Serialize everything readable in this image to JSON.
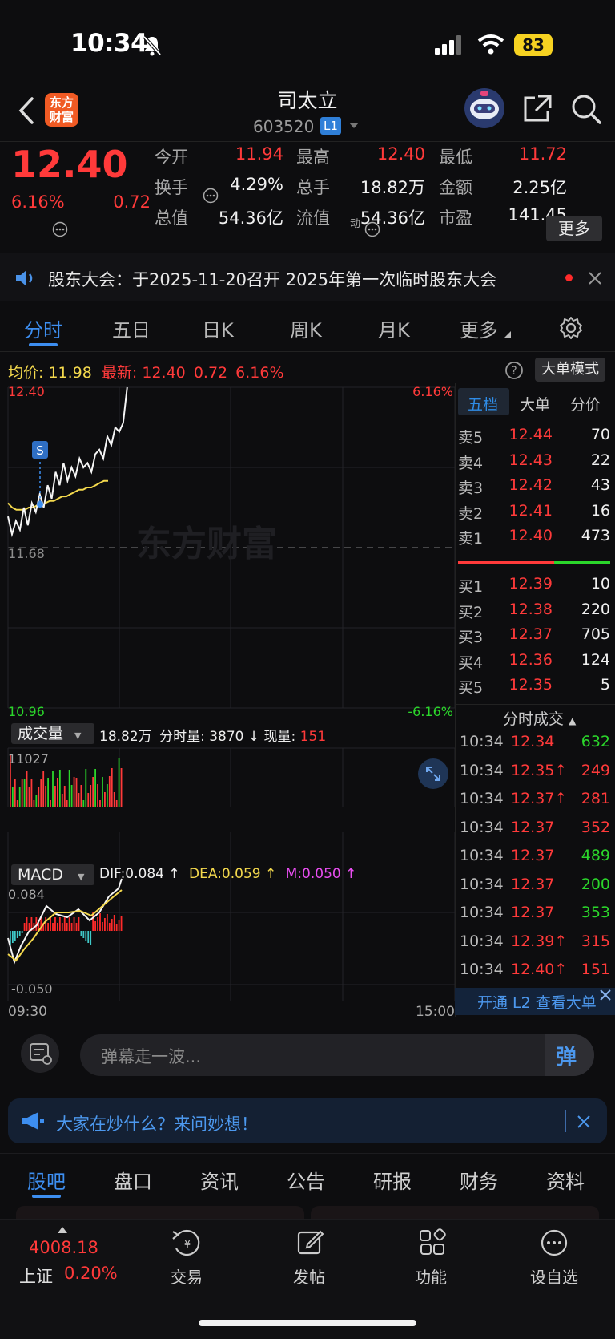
{
  "status": {
    "time": "10:34",
    "battery": "83"
  },
  "header": {
    "logo_text": "东方\n财富",
    "name": "司太立",
    "code": "603520",
    "badge": "L1"
  },
  "quote": {
    "price": "12.40",
    "change_pct": "6.16%",
    "change": "0.72",
    "rows": [
      [
        {
          "k": "今开",
          "v": "11.94",
          "c": "red"
        },
        {
          "k": "最高",
          "v": "12.40",
          "c": "red"
        },
        {
          "k": "最低",
          "v": "11.72",
          "c": "red"
        }
      ],
      [
        {
          "k": "换手",
          "v": "4.29%",
          "c": "white"
        },
        {
          "k": "总手",
          "v": "18.82万",
          "c": "white"
        },
        {
          "k": "金额",
          "v": "2.25亿",
          "c": "white"
        }
      ],
      [
        {
          "k": "总值",
          "v": "54.36亿",
          "c": "white"
        },
        {
          "k": "流值",
          "v": "54.36亿",
          "c": "white"
        },
        {
          "k": "市盈",
          "v": "141.45",
          "c": "white"
        }
      ]
    ],
    "pe_sup": "动",
    "more": "更多"
  },
  "notice": {
    "text": "股东大会：于2025-11-20召开 2025年第一次临时股东大会"
  },
  "tabs": [
    "分时",
    "五日",
    "日K",
    "周K",
    "月K",
    "更多"
  ],
  "chart_info": {
    "avg_label": "均价:",
    "avg": "11.98",
    "latest_label": "最新:",
    "latest": "12.40",
    "chg": "0.72",
    "pct": "6.16%",
    "mode_btn": "大单模式",
    "y_top": "12.40",
    "y_mid": "11.68",
    "y_bot": "10.96",
    "pct_top": "6.16%",
    "pct_bot": "-6.16%",
    "s_marker": "S",
    "watermark": "东方财富"
  },
  "chart_data": {
    "type": "line",
    "x_range": [
      "09:30",
      "15:00"
    ],
    "ylim": [
      10.96,
      12.4
    ],
    "series": [],
    "price_points": [
      11.82,
      11.74,
      11.8,
      11.76,
      11.86,
      11.78,
      11.88,
      11.84,
      11.92,
      11.86,
      11.96,
      11.9,
      12.02,
      11.96,
      12.06,
      11.98,
      12.04,
      12.0,
      12.08,
      12.04,
      12.06,
      12.02,
      12.1,
      12.12,
      12.08,
      12.18,
      12.14,
      12.22,
      12.2,
      12.24,
      12.4
    ],
    "avg_points": [
      11.88,
      11.86,
      11.85,
      11.85,
      11.85,
      11.86,
      11.86,
      11.87,
      11.87,
      11.88,
      11.89,
      11.89,
      11.9,
      11.91,
      11.91,
      11.92,
      11.93,
      11.94,
      11.94,
      11.95,
      11.95,
      11.96,
      11.97,
      11.98,
      11.98
    ],
    "volume": {
      "label": "成交量",
      "total": "18.82万",
      "period_label": "分时量:",
      "period": "3870",
      "current_label": "现量:",
      "current": "151",
      "max": "11027"
    },
    "macd": {
      "label": "MACD",
      "dif": "DIF:0.084",
      "dea": "DEA:0.059",
      "m": "M:0.050",
      "top": "0.084",
      "bot": "-0.050"
    }
  },
  "orderbook": {
    "tabs": [
      "五档",
      "大单",
      "分价"
    ],
    "asks": [
      [
        "卖5",
        "12.44",
        "70"
      ],
      [
        "卖4",
        "12.43",
        "22"
      ],
      [
        "卖3",
        "12.42",
        "43"
      ],
      [
        "卖2",
        "12.41",
        "16"
      ],
      [
        "卖1",
        "12.40",
        "473"
      ]
    ],
    "bids": [
      [
        "买1",
        "12.39",
        "10"
      ],
      [
        "买2",
        "12.38",
        "220"
      ],
      [
        "买3",
        "12.37",
        "705"
      ],
      [
        "买4",
        "12.36",
        "124"
      ],
      [
        "买5",
        "12.35",
        "5"
      ]
    ],
    "ticks_title": "分时成交",
    "ticks": [
      [
        "10:34",
        "12.34",
        "",
        "632",
        "green"
      ],
      [
        "10:34",
        "12.35",
        "↑",
        "249",
        "red"
      ],
      [
        "10:34",
        "12.37",
        "↑",
        "281",
        "red"
      ],
      [
        "10:34",
        "12.37",
        "",
        "352",
        "red"
      ],
      [
        "10:34",
        "12.37",
        "",
        "489",
        "green"
      ],
      [
        "10:34",
        "12.37",
        "",
        "200",
        "green"
      ],
      [
        "10:34",
        "12.37",
        "",
        "353",
        "green"
      ],
      [
        "10:34",
        "12.39",
        "↑",
        "315",
        "red"
      ],
      [
        "10:34",
        "12.40",
        "↑",
        "151",
        "red"
      ]
    ],
    "l2_banner": "开通 L2 查看大单"
  },
  "danmu": {
    "placeholder": "弹幕走一波...",
    "btn": "弹"
  },
  "ask_bar": {
    "text": "大家在炒什么？来问妙想！"
  },
  "subnav": [
    "股吧",
    "盘口",
    "资讯",
    "公告",
    "研报",
    "财务",
    "资料"
  ],
  "dock": {
    "index_value": "4008.18",
    "index_name": "上证",
    "index_pct": "0.20%",
    "items": [
      "交易",
      "发帖",
      "功能",
      "设自选"
    ]
  },
  "colors": {
    "up": "#ff3a3a",
    "down": "#2bd62b",
    "accent": "#2f8ce6",
    "avg_line": "#f4d94d"
  }
}
